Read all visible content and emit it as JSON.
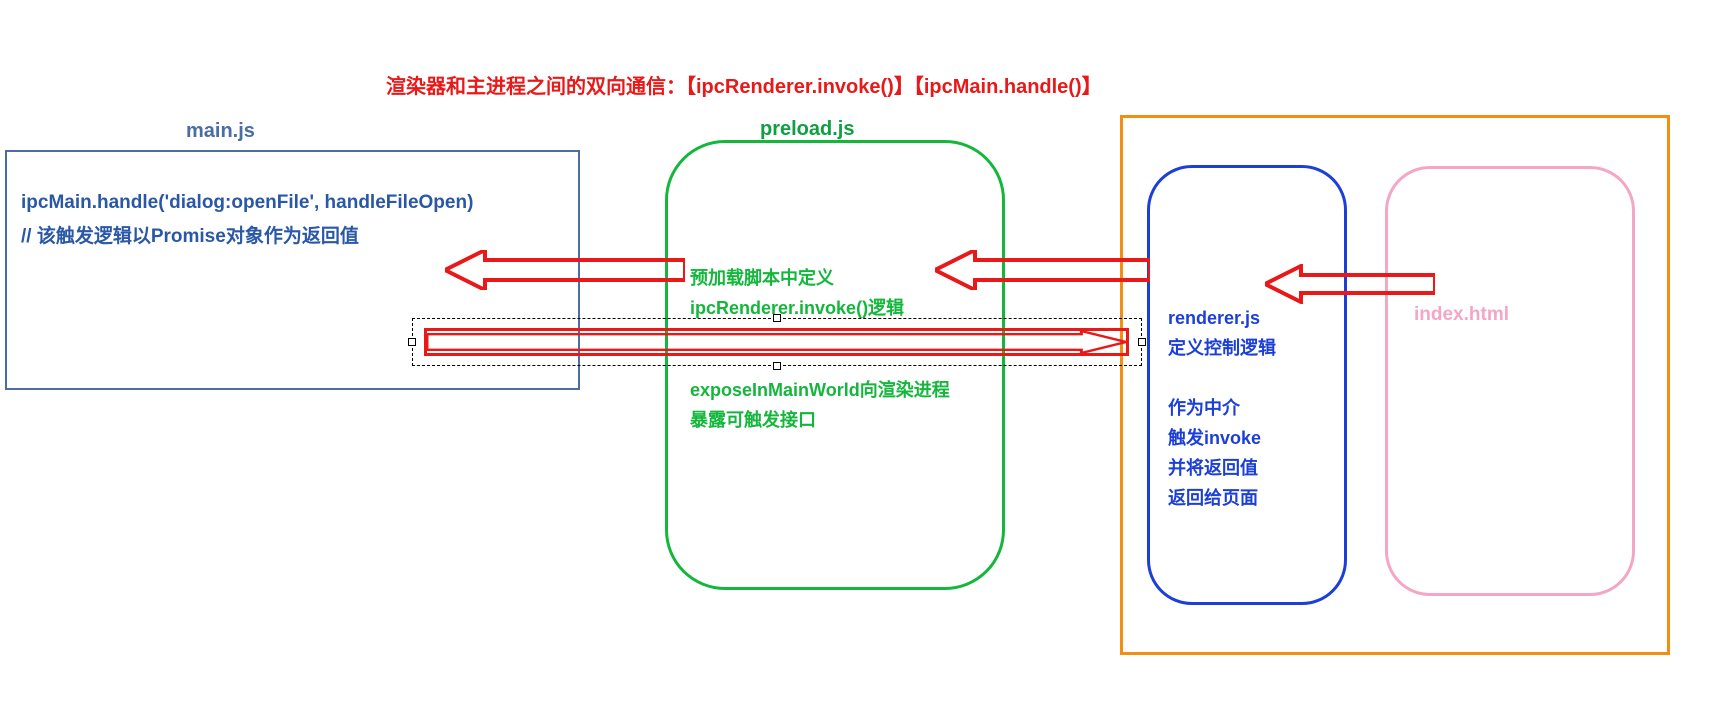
{
  "title": "渲染器和主进程之间的双向通信：【ipcRenderer.invoke()】【ipcMain.handle()】",
  "labels": {
    "main": "main.js",
    "preload": "preload.js"
  },
  "main_box": {
    "line1": "ipcMain.handle('dialog:openFile', handleFileOpen)",
    "line2": "// 该触发逻辑以Promise对象作为返回值"
  },
  "preload_box": {
    "p1l1": "预加载脚本中定义",
    "p1l2": "ipcRenderer.invoke()逻辑",
    "p2l1": "exposeInMainWorld向渲染进程",
    "p2l2": "暴露可触发接口"
  },
  "renderer_box": {
    "title": "renderer.js",
    "p1": "定义控制逻辑",
    "p2l1": "作为中介",
    "p2l2": "触发invoke",
    "p2l3": "并将返回值",
    "p2l4": "返回给页面"
  },
  "index_box": {
    "title": "index.html"
  },
  "colors": {
    "red": "#e91919",
    "blue_fill": "#4a6da3",
    "blue_text": "#2a58a6",
    "green": "#14b73c",
    "orange": "#f28f10",
    "darkblue": "#1b3fd8",
    "pink": "#f4a6c5"
  }
}
